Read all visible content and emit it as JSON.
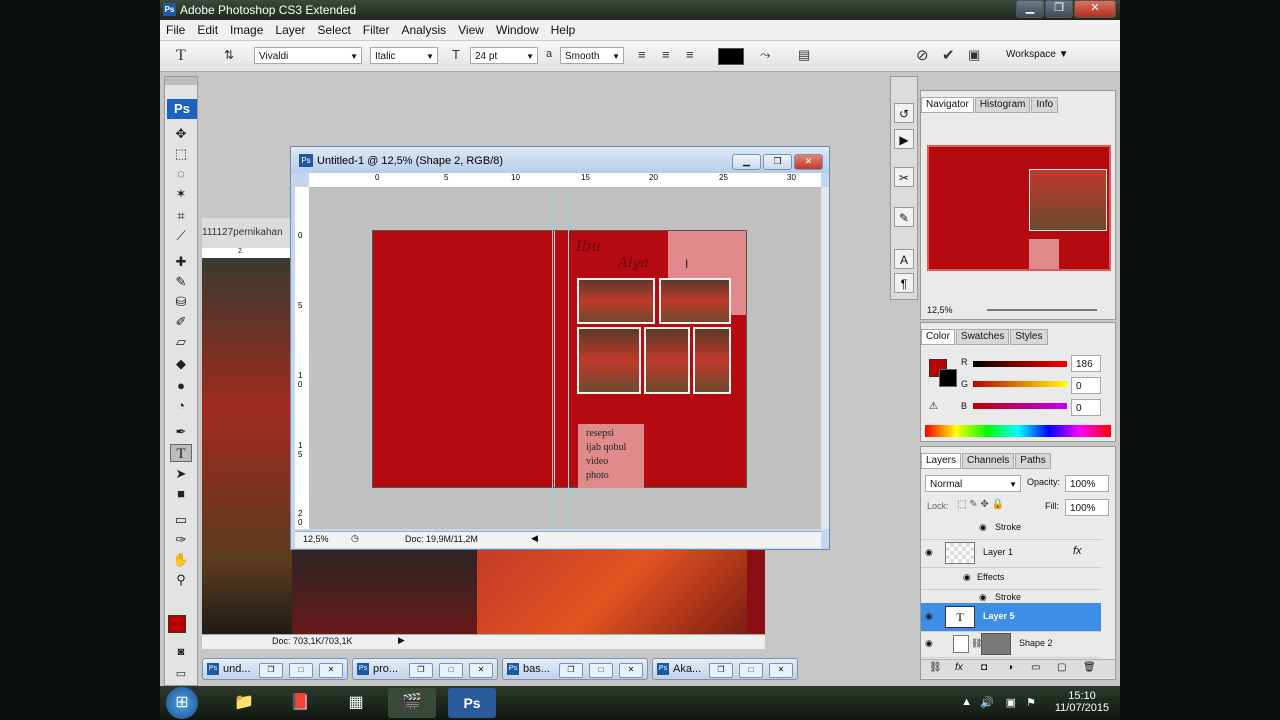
{
  "window": {
    "title": "Adobe Photoshop CS3 Extended",
    "controls": {
      "min": "▁",
      "max": "❐",
      "close": "✕"
    }
  },
  "menu": [
    "File",
    "Edit",
    "Image",
    "Layer",
    "Select",
    "Filter",
    "Analysis",
    "View",
    "Window",
    "Help"
  ],
  "options": {
    "font_family": "Vivaldi",
    "font_style": "Italic",
    "font_size": "24 pt",
    "antialias_symbol": "a",
    "antialias": "Smooth",
    "workspace": "Workspace ▼",
    "text_color": "#000000"
  },
  "document": {
    "title": "Untitled-1 @ 12,5% (Shape 2, RGB/8)",
    "zoom": "12,5%",
    "doc_size": "Doc: 19,9M/11,2M",
    "ruler_top": [
      "0",
      "5",
      "10",
      "15",
      "20",
      "25",
      "30"
    ],
    "ruler_left": [
      "0",
      "5",
      "1\n0",
      "1\n5",
      "2\n0"
    ],
    "caption_lines": [
      "resepsi",
      "ijab qobul",
      "video",
      "photo"
    ],
    "script_line1": "Ibu",
    "script_line2": "Alya"
  },
  "background_doc": {
    "tab_label": "111127pernikahan",
    "doc_size": "Doc: 703,1K/703,1K",
    "ruler_mark": "2"
  },
  "navigator": {
    "tabs": [
      "Navigator",
      "Histogram",
      "Info"
    ],
    "zoom": "12,5%"
  },
  "color_panel": {
    "tabs": [
      "Color",
      "Swatches",
      "Styles"
    ],
    "r_label": "R",
    "g_label": "G",
    "b_label": "B",
    "r": "186",
    "g": "0",
    "b": "0",
    "fg_color": "#ba0000",
    "bg_color": "#000000"
  },
  "layers_panel": {
    "tabs": [
      "Layers",
      "Channels",
      "Paths"
    ],
    "blend_mode": "Normal",
    "opacity_label": "Opacity:",
    "opacity": "100%",
    "lock_label": "Lock:",
    "fill_label": "Fill:",
    "fill": "100%",
    "rows": [
      {
        "label": "Stroke",
        "kind": "effect"
      },
      {
        "label": "Layer 1",
        "kind": "layer",
        "fx": "fx"
      },
      {
        "label": "Effects",
        "kind": "effect-header"
      },
      {
        "label": "Stroke",
        "kind": "effect"
      },
      {
        "label": "Layer 5",
        "kind": "text-layer",
        "selected": true,
        "thumb": "T"
      },
      {
        "label": "Shape 2",
        "kind": "shape"
      }
    ]
  },
  "doc_tabs": [
    {
      "label": "und...",
      "icon": "Ps"
    },
    {
      "label": "pro...",
      "icon": "Ps"
    },
    {
      "label": "bas...",
      "icon": "Ps"
    },
    {
      "label": "Aka...",
      "icon": "Ps"
    }
  ],
  "taskbar": {
    "ps_label": "Ps",
    "time": "15:10",
    "date": "11/07/2015"
  },
  "colors": {
    "accent": "#3d8ee6",
    "artboard": "#b50a0f",
    "pink": "#e08a8c"
  }
}
